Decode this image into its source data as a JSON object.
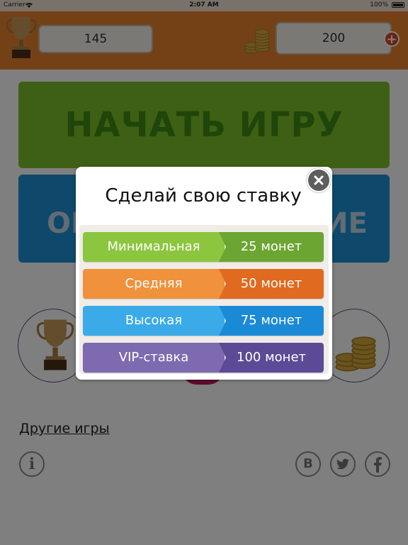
{
  "status_bar": {
    "carrier": "Carrier",
    "time": "2:07 AM",
    "battery": "100%"
  },
  "top_bar": {
    "trophies_count": "145",
    "coins_count": "200",
    "add_coins_label": "+"
  },
  "main": {
    "start_button_label": "НАЧАТЬ ИГРУ",
    "second_button_left_text": "ОН",
    "second_button_right_text": "ИЕ",
    "other_games_label": "Другие игры"
  },
  "footer": {
    "info_label": "i",
    "vk_label": "B"
  },
  "modal": {
    "title": "Сделай свою ставку",
    "bets": [
      {
        "label": "Минимальная",
        "amount": "25 монет",
        "color_light": "#8cc63f",
        "color_dark": "#6ca531"
      },
      {
        "label": "Средняя",
        "amount": "50 монет",
        "color_light": "#f0913b",
        "color_dark": "#e06a1f"
      },
      {
        "label": "Высокая",
        "amount": "75 монет",
        "color_light": "#3aabe8",
        "color_dark": "#1b8ad6"
      },
      {
        "label": "VIP-ставка",
        "amount": "100 монет",
        "color_light": "#7e6ab0",
        "color_dark": "#5c4a96"
      }
    ]
  },
  "colors": {
    "top_bar": "#e8832f",
    "start_button": "#7cc028",
    "second_button": "#1d92d8",
    "plus": "#d8461f"
  },
  "icons": [
    "trophy-icon",
    "coins-icon",
    "plus-icon",
    "close-icon",
    "info-icon",
    "vk-icon",
    "twitter-icon",
    "facebook-icon",
    "wifi-icon",
    "battery-icon"
  ]
}
